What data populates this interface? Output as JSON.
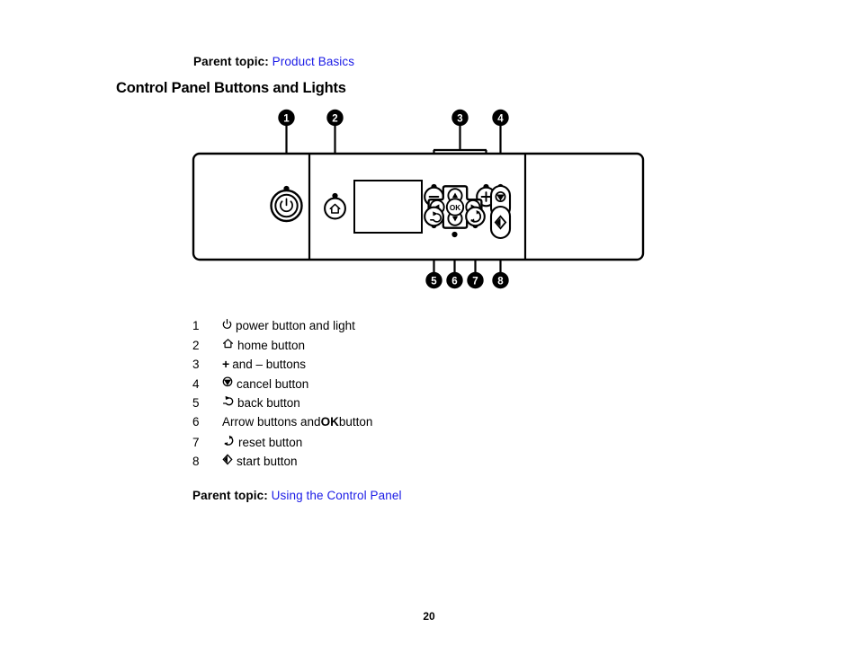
{
  "document": {
    "page_number": "20",
    "link_color": "#1a1ae6"
  },
  "parent_topic_top": {
    "label": "Parent topic:",
    "link": "Product Basics"
  },
  "heading": {
    "title": "Control Panel Buttons and Lights"
  },
  "figure": {
    "callouts": [
      {
        "number": "1",
        "target": "power-button"
      },
      {
        "number": "2",
        "target": "home-button"
      },
      {
        "number": "3",
        "target": "plus-minus-buttons"
      },
      {
        "number": "4",
        "target": "cancel-button"
      },
      {
        "number": "5",
        "target": "back-button"
      },
      {
        "number": "6",
        "target": "arrow-ok-buttons"
      },
      {
        "number": "7",
        "target": "reset-button"
      },
      {
        "number": "8",
        "target": "start-button"
      }
    ],
    "panel_buttons": {
      "power": "power-icon",
      "home": "home-icon",
      "minus": "−",
      "plus": "+",
      "ok": "OK",
      "up": "▲",
      "down": "▼",
      "left": "◀",
      "right": "▶",
      "back": "back-arrow-icon",
      "reset": "reset-icon",
      "cancel": "cancel-icon",
      "start": "start-diamond-icon"
    }
  },
  "legend": {
    "rows": [
      {
        "num": "1",
        "icon": "power-icon",
        "text": "power button and light"
      },
      {
        "num": "2",
        "icon": "home-icon",
        "text": "home button"
      },
      {
        "num": "3",
        "icon": "plus-sign",
        "text": "and – buttons",
        "prefix": "+"
      },
      {
        "num": "4",
        "icon": "cancel-icon",
        "text": "cancel button"
      },
      {
        "num": "5",
        "icon": "back-icon",
        "text": "back button"
      },
      {
        "num": "6",
        "icon": "none",
        "text": "Arrow buttons and ",
        "bold": "OK",
        "text_after": " button"
      },
      {
        "num": "7",
        "icon": "reset-icon",
        "text": "reset button"
      },
      {
        "num": "8",
        "icon": "start-icon",
        "text": "start button"
      }
    ]
  },
  "parent_topic_bottom": {
    "label": "Parent topic:",
    "link": "Using the Control Panel"
  }
}
